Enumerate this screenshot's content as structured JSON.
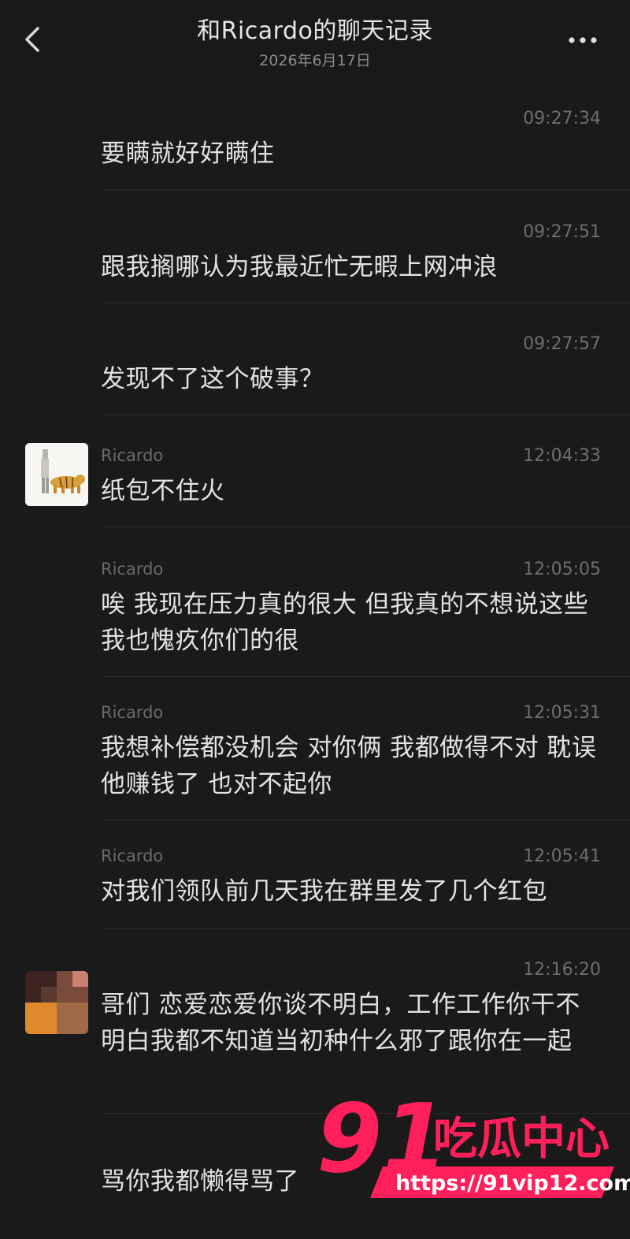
{
  "header": {
    "title": "和Ricardo的聊天记录",
    "date": "2026年6月17日",
    "back_icon": "chevron-left-icon",
    "more_icon": "more-dots-icon"
  },
  "messages": [
    {
      "sender": "",
      "time": "09:27:34",
      "text": "要瞒就好好瞒住"
    },
    {
      "sender": "",
      "time": "09:27:51",
      "text": "跟我搁哪认为我最近忙无暇上网冲浪"
    },
    {
      "sender": "",
      "time": "09:27:57",
      "text": "发现不了这个破事？"
    },
    {
      "sender": "Ricardo",
      "time": "12:04:33",
      "text": "纸包不住火"
    },
    {
      "sender": "Ricardo",
      "time": "12:05:05",
      "text": "唉 我现在压力真的很大 但我真的不想说这些 我也愧疚你们的很"
    },
    {
      "sender": "Ricardo",
      "time": "12:05:31",
      "text": "我想补偿都没机会 对你俩 我都做得不对 耽误他赚钱了 也对不起你"
    },
    {
      "sender": "Ricardo",
      "time": "12:05:41",
      "text": "对我们领队前几天我在群里发了几个红包"
    },
    {
      "sender": "",
      "time": "12:16:20",
      "text": "哥们 恋爱恋爱你谈不明白，工作工作你干不明白我都不知道当初种什么邪了跟你在一起"
    },
    {
      "sender": "",
      "time": "",
      "text": "骂你我都懒得骂了"
    }
  ],
  "watermark": {
    "number": "91",
    "name": "吃瓜中心",
    "url": "https://91vip12.com",
    "color": "#ff1f5a"
  }
}
